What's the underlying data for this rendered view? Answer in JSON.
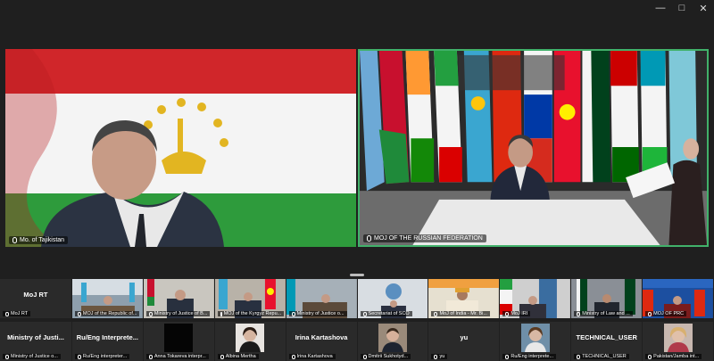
{
  "window": {
    "minimize_icon": "minimize-icon",
    "maximize_icon": "maximize-icon",
    "close_icon": "close-icon"
  },
  "main_tiles": [
    {
      "label": "Mo. of Tajikistan",
      "speaking": false
    },
    {
      "label": "MOJ OF THE RUSSIAN FEDERATION",
      "speaking": true
    }
  ],
  "gallery_row1": [
    {
      "name": "MoJ RT",
      "label": "MoJ RT",
      "type": "name"
    },
    {
      "name": "",
      "label": "MOJ of the Republic of...",
      "type": "video"
    },
    {
      "name": "",
      "label": "Ministry of Justice of B...",
      "type": "video"
    },
    {
      "name": "",
      "label": "MOJ of the Kyrgyz Repu...",
      "type": "video"
    },
    {
      "name": "",
      "label": "Ministry of Justice o...",
      "type": "video"
    },
    {
      "name": "",
      "label": "Secretariat of SCO",
      "type": "video"
    },
    {
      "name": "",
      "label": "MoJ of India - Mr. Bi...",
      "type": "video"
    },
    {
      "name": "",
      "label": "MoJ IRI",
      "type": "video"
    },
    {
      "name": "",
      "label": "Ministry of Law and ...",
      "type": "video"
    },
    {
      "name": "",
      "label": "MOJ OF PRC",
      "type": "video"
    }
  ],
  "gallery_row2": [
    {
      "name": "Ministry of Justi...",
      "label": "Ministry of Justice o...",
      "type": "name"
    },
    {
      "name": "Ru/Eng Interprete...",
      "label": "Ru/Eng interpreter...",
      "type": "name"
    },
    {
      "name": "",
      "label": "Anna Tokareva interpr...",
      "type": "avatar-dark"
    },
    {
      "name": "",
      "label": "Albina Mertha",
      "type": "avatar"
    },
    {
      "name": "Irina Kartashova",
      "label": "Irina Kartashova",
      "type": "name"
    },
    {
      "name": "",
      "label": "Dmitrii Sukhotyd...",
      "type": "avatar"
    },
    {
      "name": "yu",
      "label": "yu",
      "type": "name"
    },
    {
      "name": "",
      "label": "Ru/Eng interprete...",
      "type": "avatar"
    },
    {
      "name": "TECHNICAL_USER",
      "label": "TECHNICAL_USER",
      "type": "name"
    },
    {
      "name": "",
      "label": "Pakistan/Jamba int...",
      "type": "avatar"
    }
  ],
  "colors": {
    "speaker_border": "#41b16a",
    "background": "#1f1f1f"
  }
}
